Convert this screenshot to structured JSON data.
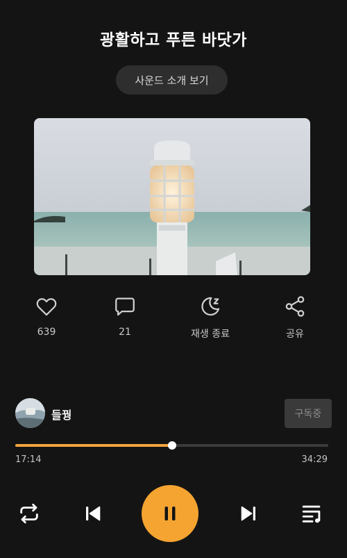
{
  "title": "광활하고 푸른 바닷가",
  "intro_button": "사운드 소개 보기",
  "actions": {
    "like": {
      "icon": "heart-icon",
      "label": "639"
    },
    "comment": {
      "icon": "comment-icon",
      "label": "21"
    },
    "sleep_timer": {
      "icon": "moon-sleep-icon",
      "label": "재생 종료"
    },
    "share": {
      "icon": "share-icon",
      "label": "공유"
    }
  },
  "channel": {
    "name": "들꿩",
    "subscribe_label": "구독중"
  },
  "player": {
    "current_time": "17:14",
    "total_time": "34:29",
    "progress": 0.5,
    "state": "playing",
    "accent_color": "#f5a431"
  },
  "controls": [
    "repeat-icon",
    "previous-icon",
    "pause-icon",
    "next-icon",
    "playlist-icon"
  ]
}
